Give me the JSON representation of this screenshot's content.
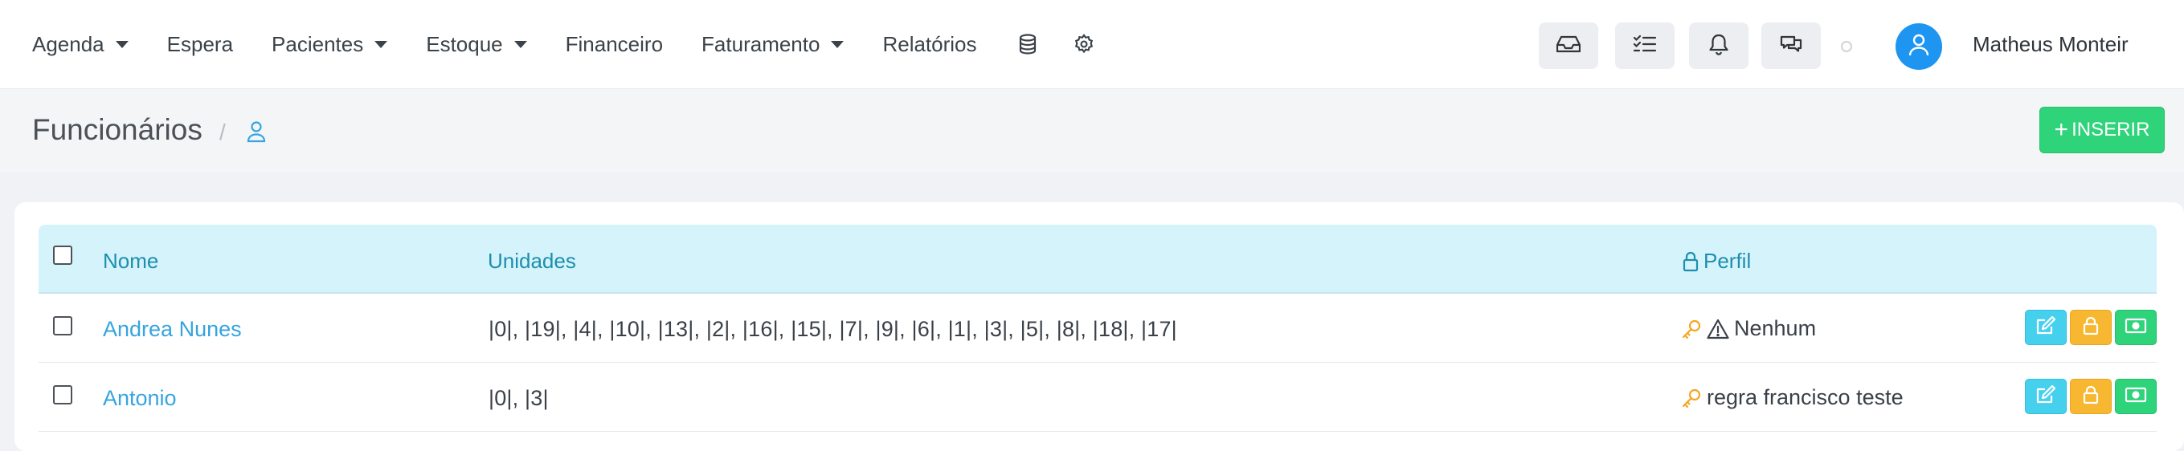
{
  "nav": {
    "menu": [
      {
        "label": "Agenda",
        "dropdown": true
      },
      {
        "label": "Espera",
        "dropdown": false
      },
      {
        "label": "Pacientes",
        "dropdown": true
      },
      {
        "label": "Estoque",
        "dropdown": true
      },
      {
        "label": "Financeiro",
        "dropdown": false
      },
      {
        "label": "Faturamento",
        "dropdown": true
      },
      {
        "label": "Relatórios",
        "dropdown": false
      }
    ],
    "icons": [
      "database-icon",
      "gear-icon"
    ],
    "right_buttons": [
      "inbox-icon",
      "tasks-icon",
      "bell-icon",
      "chat-icon"
    ],
    "user_name": "Matheus Monteir"
  },
  "page": {
    "title": "Funcionários",
    "breadcrumb_separator": "/",
    "insert_label": "INSERIR"
  },
  "table": {
    "columns": {
      "name": "Nome",
      "units": "Unidades",
      "profile": "Perfil"
    },
    "rows": [
      {
        "name": "Andrea Nunes",
        "units": "|0|, |19|, |4|, |10|, |13|, |2|, |16|, |15|, |7|, |9|, |6|, |1|, |3|, |5|, |8|, |18|, |17|",
        "profile": "Nenhum",
        "warning": true
      },
      {
        "name": "Antonio",
        "units": "|0|, |3|",
        "profile": "regra francisco teste",
        "warning": false
      }
    ]
  },
  "colors": {
    "accent_blue": "#1e95f0",
    "insert_green": "#2fd37a",
    "header_cyan": "#d5f3fb",
    "edit_cyan": "#45d0ee",
    "lock_yellow": "#f7b731",
    "money_green": "#2ed37a"
  }
}
